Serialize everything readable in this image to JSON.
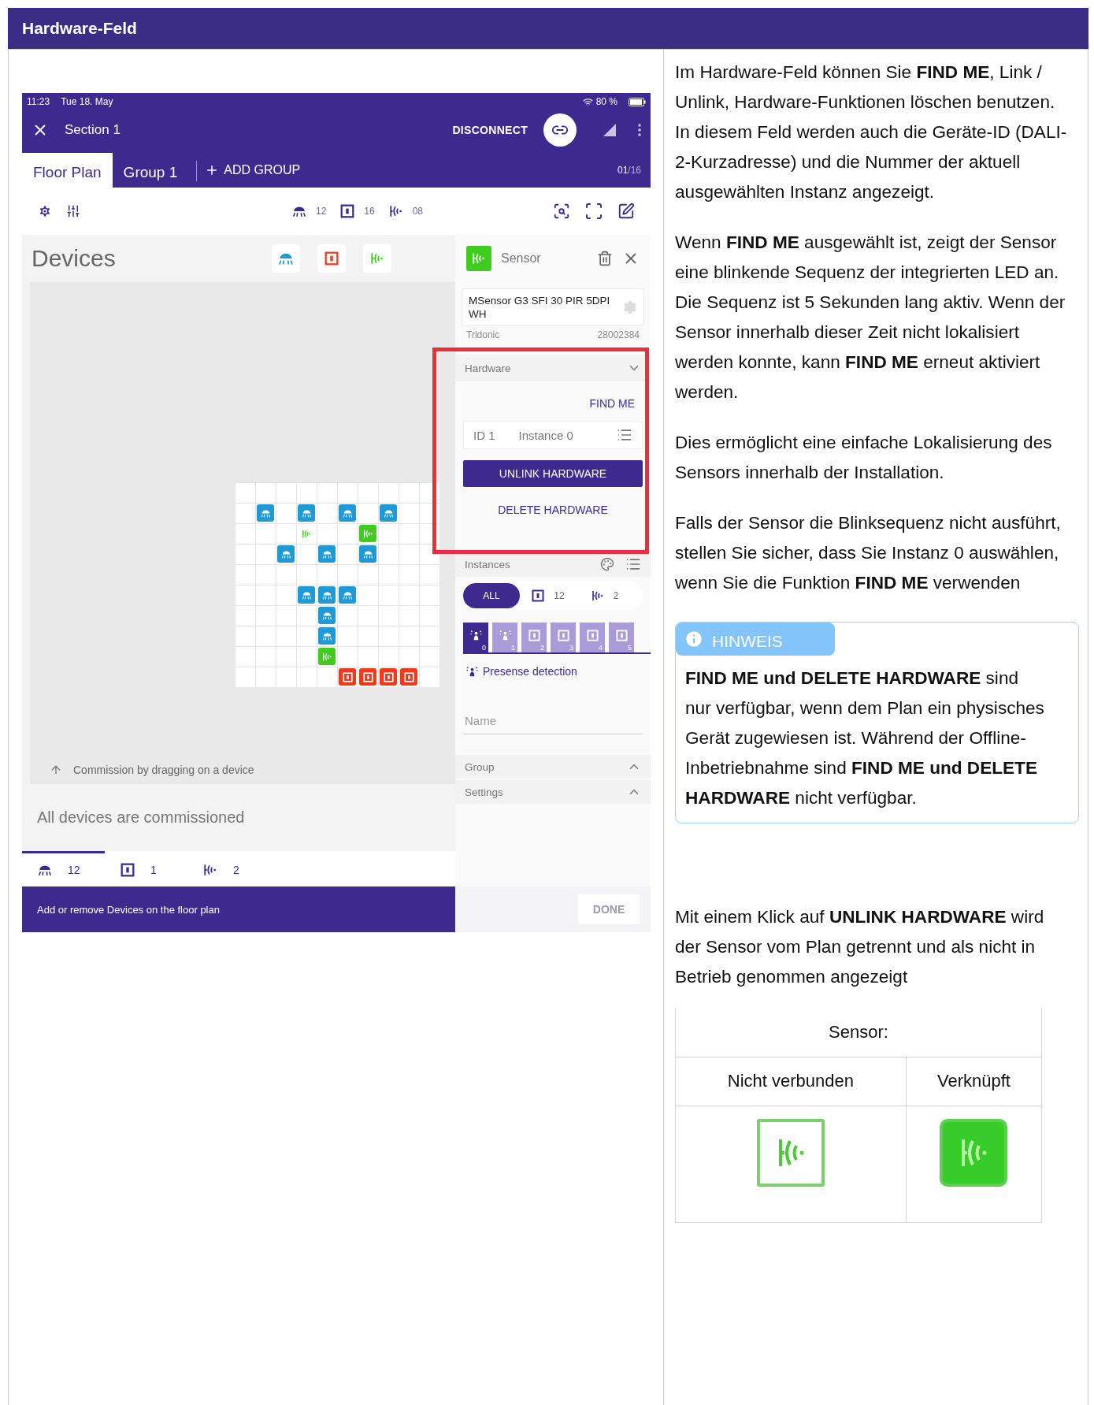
{
  "header": {
    "title": "Hardware-Feld"
  },
  "app": {
    "status_bar": {
      "time": "11:23",
      "date": "Tue 18. May",
      "battery": "80 %"
    },
    "top_bar": {
      "title": "Section 1",
      "action": "DISCONNECT"
    },
    "tabs": [
      {
        "label": "Floor Plan",
        "selected": true
      },
      {
        "label": "Group 1",
        "selected": false
      }
    ],
    "add_group": "ADD GROUP",
    "page_counter": {
      "current": "01",
      "total": "/16"
    },
    "toolbar_counts": [
      {
        "kind": "lamp",
        "count": "12"
      },
      {
        "kind": "switch",
        "count": "16"
      },
      {
        "kind": "sensor",
        "count": "08"
      }
    ],
    "devices": {
      "title": "Devices",
      "hint": "Commission by dragging on a device",
      "status": "All devices are commissioned"
    },
    "floor_plan": {
      "rows": [
        [
          {
            "kind": "empty"
          },
          {
            "kind": "empty"
          },
          {
            "kind": "empty"
          },
          {
            "kind": "empty"
          },
          {
            "kind": "empty"
          },
          {
            "kind": "empty"
          },
          {
            "kind": "empty"
          },
          {
            "kind": "empty"
          },
          {
            "kind": "empty"
          },
          {
            "kind": "empty"
          }
        ],
        [
          {
            "kind": "empty"
          },
          {
            "kind": "lamp"
          },
          {
            "kind": "empty"
          },
          {
            "kind": "lamp"
          },
          {
            "kind": "empty"
          },
          {
            "kind": "lamp"
          },
          {
            "kind": "empty"
          },
          {
            "kind": "lamp"
          },
          {
            "kind": "empty"
          },
          {
            "kind": "empty"
          }
        ],
        [
          {
            "kind": "empty"
          },
          {
            "kind": "empty"
          },
          {
            "kind": "empty"
          },
          {
            "kind": "sensor",
            "linked": false
          },
          {
            "kind": "empty"
          },
          {
            "kind": "empty"
          },
          {
            "kind": "sensor",
            "linked": true
          },
          {
            "kind": "empty"
          },
          {
            "kind": "empty"
          },
          {
            "kind": "empty"
          }
        ],
        [
          {
            "kind": "empty"
          },
          {
            "kind": "empty"
          },
          {
            "kind": "lamp"
          },
          {
            "kind": "empty"
          },
          {
            "kind": "lamp"
          },
          {
            "kind": "empty"
          },
          {
            "kind": "lamp"
          },
          {
            "kind": "empty"
          },
          {
            "kind": "empty"
          },
          {
            "kind": "empty"
          }
        ],
        [
          {
            "kind": "empty"
          },
          {
            "kind": "empty"
          },
          {
            "kind": "empty"
          },
          {
            "kind": "empty"
          },
          {
            "kind": "empty"
          },
          {
            "kind": "empty"
          },
          {
            "kind": "empty"
          },
          {
            "kind": "empty"
          },
          {
            "kind": "empty"
          },
          {
            "kind": "empty"
          }
        ],
        [
          {
            "kind": "empty"
          },
          {
            "kind": "empty"
          },
          {
            "kind": "empty"
          },
          {
            "kind": "lamp"
          },
          {
            "kind": "lamp"
          },
          {
            "kind": "lamp"
          },
          {
            "kind": "empty"
          },
          {
            "kind": "empty"
          },
          {
            "kind": "empty"
          },
          {
            "kind": "empty"
          }
        ],
        [
          {
            "kind": "empty"
          },
          {
            "kind": "empty"
          },
          {
            "kind": "empty"
          },
          {
            "kind": "empty"
          },
          {
            "kind": "lamp"
          },
          {
            "kind": "empty"
          },
          {
            "kind": "empty"
          },
          {
            "kind": "empty"
          },
          {
            "kind": "empty"
          },
          {
            "kind": "empty"
          }
        ],
        [
          {
            "kind": "empty"
          },
          {
            "kind": "empty"
          },
          {
            "kind": "empty"
          },
          {
            "kind": "empty"
          },
          {
            "kind": "lamp"
          },
          {
            "kind": "empty"
          },
          {
            "kind": "empty"
          },
          {
            "kind": "empty"
          },
          {
            "kind": "empty"
          },
          {
            "kind": "empty"
          }
        ],
        [
          {
            "kind": "empty"
          },
          {
            "kind": "empty"
          },
          {
            "kind": "empty"
          },
          {
            "kind": "empty"
          },
          {
            "kind": "sensor",
            "linked": true
          },
          {
            "kind": "empty"
          },
          {
            "kind": "empty"
          },
          {
            "kind": "empty"
          },
          {
            "kind": "empty"
          },
          {
            "kind": "empty"
          }
        ],
        [
          {
            "kind": "empty"
          },
          {
            "kind": "empty"
          },
          {
            "kind": "empty"
          },
          {
            "kind": "empty"
          },
          {
            "kind": "empty"
          },
          {
            "kind": "switch"
          },
          {
            "kind": "switch"
          },
          {
            "kind": "switch"
          },
          {
            "kind": "switch"
          },
          {
            "kind": "empty"
          }
        ]
      ]
    },
    "bottom_counts": [
      {
        "kind": "lamp",
        "count": "12",
        "selected": true
      },
      {
        "kind": "switch",
        "count": "1",
        "selected": false
      },
      {
        "kind": "sensor",
        "count": "2",
        "selected": false
      }
    ],
    "footer": {
      "text": "Add or remove Devices on the floor plan",
      "done": "DONE"
    },
    "detail": {
      "title": "Sensor",
      "product": "MSensor G3 SFI 30 PIR 5DPI WH",
      "vendor": "Tridonic",
      "article": "28002384",
      "hardware": {
        "title": "Hardware",
        "expanded": true,
        "find_me": "FIND ME",
        "id": "ID 1",
        "instance": "Instance 0",
        "unlink": "UNLINK HARDWARE",
        "delete": "DELETE HARDWARE"
      },
      "instances": {
        "title": "Instances",
        "filters": [
          {
            "kind": "all",
            "label": "ALL",
            "selected": true
          },
          {
            "kind": "switch",
            "label": "12",
            "selected": false
          },
          {
            "kind": "sensor",
            "label": "2",
            "selected": false
          }
        ],
        "tiles": [
          {
            "kind": "presence",
            "number": "0",
            "selected": true
          },
          {
            "kind": "presence",
            "number": "1",
            "selected": false
          },
          {
            "kind": "switch",
            "number": "2",
            "selected": false
          },
          {
            "kind": "switch",
            "number": "3",
            "selected": false
          },
          {
            "kind": "switch",
            "number": "4",
            "selected": false
          },
          {
            "kind": "switch",
            "number": "5",
            "selected": false
          }
        ]
      },
      "detection": "Presense detection",
      "name_placeholder": "Name",
      "sections": [
        {
          "title": "Group",
          "expanded": false
        },
        {
          "title": "Settings",
          "expanded": false
        }
      ]
    }
  },
  "paragraphs": [
    "Im Hardware-Feld können Sie **FIND ME**, Link / Unlink, Hardware-Funktionen löschen benutzen. In diesem Feld werden auch die Geräte-ID (DALI-2-Kurzadresse) und die Nummer der aktuell ausgewählten Instanz angezeigt.",
    "Wenn **FIND ME** ausgewählt ist, zeigt der Sensor eine blinkende Sequenz der integrierten LED an. Die Sequenz ist 5 Sekunden lang aktiv. Wenn der Sensor innerhalb dieser Zeit nicht lokalisiert werden konnte, kann **FIND ME** erneut aktiviert werden.",
    "Dies ermöglicht eine einfache Lokalisierung des Sensors innerhalb der Installation.",
    "Falls der Sensor die Blinksequenz nicht ausführt, stellen Sie sicher, dass Sie Instanz 0 auswählen, wenn Sie die Funktion **FIND ME** verwenden"
  ],
  "callout": {
    "label": "HINWEIS",
    "text": "**FIND ME und DELETE HARDWARE** sind nur verfügbar, wenn dem Plan ein physisches Gerät zugewiesen ist. Während der Offline-Inbetriebnahme sind **FIND ME und DELETE HARDWARE** nicht verfügbar."
  },
  "unlink_paragraph": "Mit einem Klick auf **UNLINK HARDWARE** wird der Sensor vom Plan getrennt und als nicht in Betrieb genommen angezeigt",
  "sensor_table": {
    "title": "Sensor:",
    "columns": [
      {
        "label": "Nicht verbunden",
        "linked": false
      },
      {
        "label": "Verknüpft",
        "linked": true
      }
    ]
  }
}
